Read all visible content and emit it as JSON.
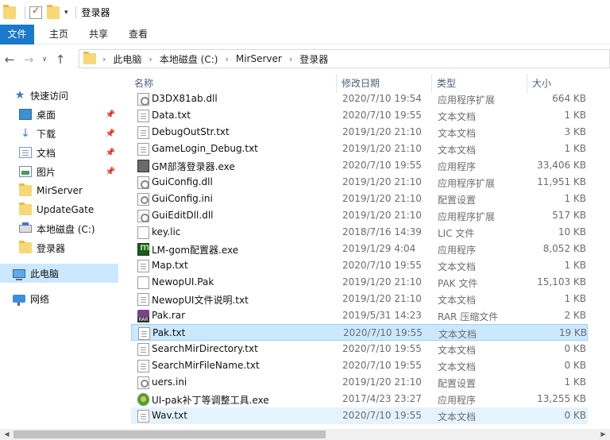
{
  "titlebar": {
    "title": "登录器",
    "quick_access": [
      "folder-icon",
      "properties-icon",
      "new-folder-icon",
      "customize-dropdown-icon"
    ]
  },
  "ribbon": {
    "tabs": [
      {
        "label": "文件",
        "active": true
      },
      {
        "label": "主页"
      },
      {
        "label": "共享"
      },
      {
        "label": "查看"
      }
    ]
  },
  "address": {
    "crumbs": [
      "此电脑",
      "本地磁盘 (C:)",
      "MirServer",
      "登录器"
    ]
  },
  "nav": {
    "quick_access": "快速访问",
    "items": [
      {
        "label": "桌面",
        "icon": "desktop-icon",
        "pinned": true
      },
      {
        "label": "下载",
        "icon": "download-icon",
        "pinned": true
      },
      {
        "label": "文档",
        "icon": "documents-icon",
        "pinned": true
      },
      {
        "label": "图片",
        "icon": "pictures-icon",
        "pinned": true
      },
      {
        "label": "MirServer",
        "icon": "folder-icon"
      },
      {
        "label": "UpdateGate",
        "icon": "folder-icon"
      },
      {
        "label": "本地磁盘 (C:)",
        "icon": "drive-icon"
      },
      {
        "label": "登录器",
        "icon": "folder-icon"
      }
    ],
    "this_pc": "此电脑",
    "network": "网络"
  },
  "columns": {
    "name": "名称",
    "date": "修改日期",
    "type": "类型",
    "size": "大小"
  },
  "files": [
    {
      "name": "D3DX81ab.dll",
      "date": "2020/7/10 19:54",
      "type": "应用程序扩展",
      "size": "664 KB",
      "icon": "dll"
    },
    {
      "name": "Data.txt",
      "date": "2020/7/10 19:55",
      "type": "文本文档",
      "size": "1 KB",
      "icon": "txt"
    },
    {
      "name": "DebugOutStr.txt",
      "date": "2019/1/20 21:10",
      "type": "文本文档",
      "size": "3 KB",
      "icon": "txt"
    },
    {
      "name": "GameLogin_Debug.txt",
      "date": "2019/1/20 21:10",
      "type": "文本文档",
      "size": "1 KB",
      "icon": "txt"
    },
    {
      "name": "GM部落登录器.exe",
      "date": "2020/7/10 19:55",
      "type": "应用程序",
      "size": "33,406 KB",
      "icon": "exe-gm"
    },
    {
      "name": "GuiConfig.dll",
      "date": "2019/1/20 21:10",
      "type": "应用程序扩展",
      "size": "11,951 KB",
      "icon": "dll"
    },
    {
      "name": "GuiConfig.ini",
      "date": "2019/1/20 21:10",
      "type": "配置设置",
      "size": "1 KB",
      "icon": "ini"
    },
    {
      "name": "GuiEditDll.dll",
      "date": "2019/1/20 21:10",
      "type": "应用程序扩展",
      "size": "517 KB",
      "icon": "dll"
    },
    {
      "name": "key.lic",
      "date": "2018/7/16 14:39",
      "type": "LIC 文件",
      "size": "10 KB",
      "icon": "blank"
    },
    {
      "name": "LM-gom配置器.exe",
      "date": "2019/1/29 4:04",
      "type": "应用程序",
      "size": "8,052 KB",
      "icon": "exe-lm"
    },
    {
      "name": "Map.txt",
      "date": "2020/7/10 19:55",
      "type": "文本文档",
      "size": "1 KB",
      "icon": "txt"
    },
    {
      "name": "NewopUI.Pak",
      "date": "2019/1/20 21:10",
      "type": "PAK 文件",
      "size": "15,103 KB",
      "icon": "blank"
    },
    {
      "name": "NewopUI文件说明.txt",
      "date": "2019/1/20 21:10",
      "type": "文本文档",
      "size": "1 KB",
      "icon": "txt"
    },
    {
      "name": "Pak.rar",
      "date": "2019/5/31 14:23",
      "type": "RAR 压缩文件",
      "size": "2 KB",
      "icon": "rar"
    },
    {
      "name": "Pak.txt",
      "date": "2020/7/10 19:55",
      "type": "文本文档",
      "size": "19 KB",
      "icon": "txt",
      "selected": true
    },
    {
      "name": "SearchMirDirectory.txt",
      "date": "2020/7/10 19:55",
      "type": "文本文档",
      "size": "0 KB",
      "icon": "txt"
    },
    {
      "name": "SearchMirFileName.txt",
      "date": "2020/7/10 19:55",
      "type": "文本文档",
      "size": "0 KB",
      "icon": "txt"
    },
    {
      "name": "uers.ini",
      "date": "2019/1/20 21:10",
      "type": "配置设置",
      "size": "1 KB",
      "icon": "ini"
    },
    {
      "name": "UI-pak补丁等调整工具.exe",
      "date": "2017/4/23 23:27",
      "type": "应用程序",
      "size": "13,255 KB",
      "icon": "exe-ui"
    },
    {
      "name": "Wav.txt",
      "date": "2020/7/10 19:55",
      "type": "文本文档",
      "size": "0 KB",
      "icon": "txt",
      "hovered": true
    }
  ]
}
